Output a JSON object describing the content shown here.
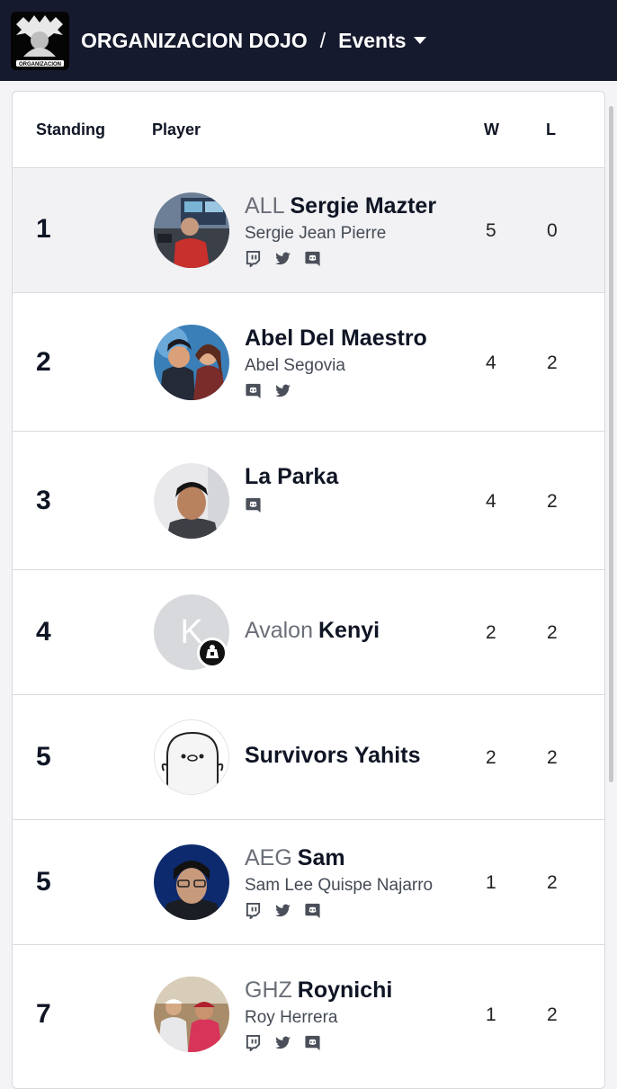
{
  "header": {
    "org_name": "ORGANIZACION DOJO",
    "separator": "/",
    "section": "Events",
    "logo_text": "ORGANIZACION"
  },
  "table": {
    "headers": {
      "standing": "Standing",
      "player": "Player",
      "wins": "W",
      "losses": "L"
    },
    "rows": [
      {
        "standing": "1",
        "prefix": "ALL",
        "gamer_tag": "Sergie Mazter",
        "real_name": "Sergie Jean Pierre",
        "socials": [
          "twitch-icon",
          "twitter-icon",
          "discord-icon"
        ],
        "wins": "5",
        "losses": "0"
      },
      {
        "standing": "2",
        "prefix": "",
        "gamer_tag": "Abel Del Maestro",
        "real_name": "Abel Segovia",
        "socials": [
          "discord-icon",
          "twitter-icon"
        ],
        "wins": "4",
        "losses": "2"
      },
      {
        "standing": "3",
        "prefix": "",
        "gamer_tag": "La Parka",
        "real_name": "",
        "socials": [
          "discord-icon"
        ],
        "wins": "4",
        "losses": "2"
      },
      {
        "standing": "4",
        "prefix": "Avalon",
        "gamer_tag": "Kenyi",
        "real_name": "",
        "socials": [],
        "wins": "2",
        "losses": "2",
        "avatar_initial": "K"
      },
      {
        "standing": "5",
        "prefix": "",
        "gamer_tag": "Survivors Yahits",
        "real_name": "",
        "socials": [],
        "wins": "2",
        "losses": "2"
      },
      {
        "standing": "5",
        "prefix": "AEG",
        "gamer_tag": "Sam",
        "real_name": "Sam Lee Quispe Najarro",
        "socials": [
          "twitch-icon",
          "twitter-icon",
          "discord-icon"
        ],
        "wins": "1",
        "losses": "2"
      },
      {
        "standing": "7",
        "prefix": "GHZ",
        "gamer_tag": "Roynichi",
        "real_name": "Roy Herrera",
        "socials": [
          "twitch-icon",
          "twitter-icon",
          "discord-icon"
        ],
        "wins": "1",
        "losses": "2"
      }
    ]
  },
  "colors": {
    "header_bg": "#161a2e",
    "prefix_gray": "#6b6f78",
    "highlight_row": "#f2f2f4"
  }
}
